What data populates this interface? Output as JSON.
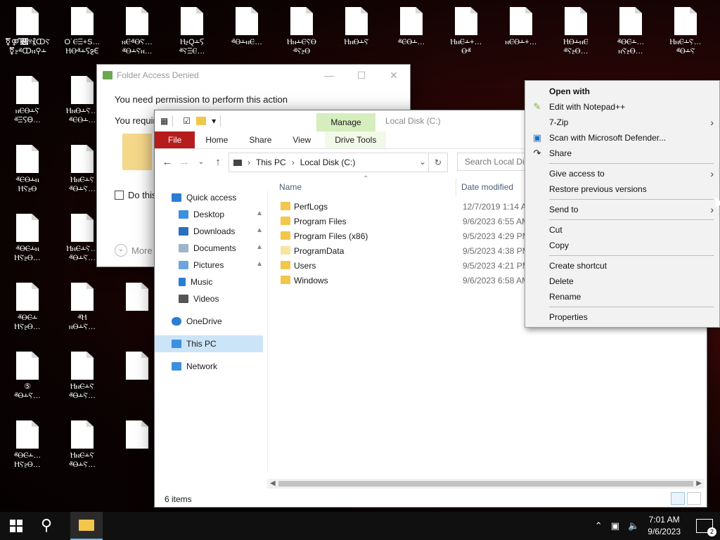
{
  "desktop": {
    "icons": [
      {
        "label1": "⚧⚤𑱇ⱄ⳩ↀⲊ",
        "label2": "⚧ⳉⱏↀⲛ⚲Ⲳ"
      },
      {
        "label1": "O˙ⲈⲶ+S…",
        "label2": "ⲎⲐⱏⲲⲊⳉⲈ"
      },
      {
        "label1": "ⲛⲈⱏⲐⲊ…",
        "label2": "ⱏⲐⲲⲊⲛ…"
      },
      {
        "label1": "ⲎⳉQⲲⲊ",
        "label2": "ⱏⲊⲶⲈ…"
      },
      {
        "label1": "ⱏⲐⲲⲛⲈ…",
        "label2": ""
      },
      {
        "label1": "ⲎⲛⲲⲈⲊⲐ",
        "label2": "ⱏⲊⳉⲐ"
      },
      {
        "label1": "ⲎⲛⲐⲲⲊ",
        "label2": ""
      },
      {
        "label1": "ⱏⲈⲐⲲ…",
        "label2": ""
      },
      {
        "label1": "ⲎⲛⲈⲲ+…",
        "label2": "Ⲑⱏ"
      },
      {
        "label1": "ⲛⲈⲐⲲ+…",
        "label2": ""
      },
      {
        "label1": "ⲎⲐⲲⲛⲈ",
        "label2": "ⱏⲊⳉⲐ…"
      },
      {
        "label1": "ⱏⲐⲈⲲ…",
        "label2": "ⲛⲊⳉⲐ…"
      },
      {
        "label1": "ⲎⲛⲈⲲⲊ…",
        "label2": "ⱏⲐⲲⲊ"
      },
      {
        "label1": "ⲛⲈⲐⲲⲊ",
        "label2": "ⱏⲶⲊⲐ…"
      },
      {
        "label1": "ⲎⲛⲐⲲⲊ…",
        "label2": "ⱏⲈⲐⲲ…"
      },
      {
        "label1": "ⱏⲈⲐⲲⲛ",
        "label2": "ⲎⲊⳉⲐ"
      },
      {
        "label1": "ⲎⲛⲈⲲⲊ",
        "label2": "ⱏⲐⲲⲊ…"
      },
      {
        "label1": "ⱏⲐⲈⲲⲛ",
        "label2": "ⲎⲊⳉⲐ…"
      },
      {
        "label1": "ⲎⲛⲈⲲⲊ…",
        "label2": "ⱏⲐⲲⲊ…"
      },
      {
        "label1": "ⱏⲐⲈⲲ",
        "label2": "ⲎⲊⳉⲐ…"
      },
      {
        "label1": "ⱏⲎ",
        "label2": "ⲛⲐⲲⲊ…"
      },
      {
        "label1": "⑤",
        "label2": "ⱏⲐⲲⲊ…"
      },
      {
        "label1": "ⲎⲛⲈⲲⲊ",
        "label2": "ⱏⲐⲲⲊ…"
      },
      {
        "label1": "ⱏⲐⲈⲲ…",
        "label2": "ⲎⲊⳉⲐ…"
      },
      {
        "label1": "ⲎⲛⲈⲲⲊ",
        "label2": "ⱏⲐⲲⲊ…"
      }
    ]
  },
  "dialog": {
    "title": "Folder Access Denied",
    "message": "You need permission to perform this action",
    "message2": "You require",
    "checkbox_label": "Do this",
    "more_label": "More"
  },
  "explorer": {
    "qa_dropdown": "▾",
    "context_tab": "Manage",
    "window_title": "Local Disk (C:)",
    "tabs": {
      "file": "File",
      "home": "Home",
      "share": "Share",
      "view": "View",
      "drive_tools": "Drive Tools"
    },
    "breadcrumb": [
      "This PC",
      "Local Disk (C:)"
    ],
    "search_placeholder": "Search Local Disk (C:)",
    "nav": {
      "quick_access": "Quick access",
      "desktop": "Desktop",
      "downloads": "Downloads",
      "documents": "Documents",
      "pictures": "Pictures",
      "music": "Music",
      "videos": "Videos",
      "onedrive": "OneDrive",
      "this_pc": "This PC",
      "network": "Network"
    },
    "columns": {
      "name": "Name",
      "date": "Date modified"
    },
    "files": [
      {
        "name": "PerfLogs",
        "date": "12/7/2019 1:14 AM"
      },
      {
        "name": "Program Files",
        "date": "9/6/2023 6:55 AM"
      },
      {
        "name": "Program Files (x86)",
        "date": "9/5/2023 4:29 PM"
      },
      {
        "name": "ProgramData",
        "date": "9/5/2023 4:38 PM"
      },
      {
        "name": "Users",
        "date": "9/5/2023 4:21 PM"
      },
      {
        "name": "Windows",
        "date": "9/6/2023 6:58 AM"
      }
    ],
    "status": "6 items"
  },
  "context_menu": {
    "open_with": "Open with",
    "edit_notepad": "Edit with Notepad++",
    "seven_zip": "7-Zip",
    "defender": "Scan with Microsoft Defender...",
    "share": "Share",
    "give_access": "Give access to",
    "restore": "Restore previous versions",
    "send_to": "Send to",
    "cut": "Cut",
    "copy": "Copy",
    "create_shortcut": "Create shortcut",
    "delete": "Delete",
    "rename": "Rename",
    "properties": "Properties"
  },
  "taskbar": {
    "time": "7:01 AM",
    "date": "9/6/2023",
    "notification_count": "2"
  },
  "colors": {
    "file_tab": "#b71c1c",
    "manage_tab": "#d6edbd",
    "folder": "#f3c64c",
    "selection": "#cce4f7"
  }
}
